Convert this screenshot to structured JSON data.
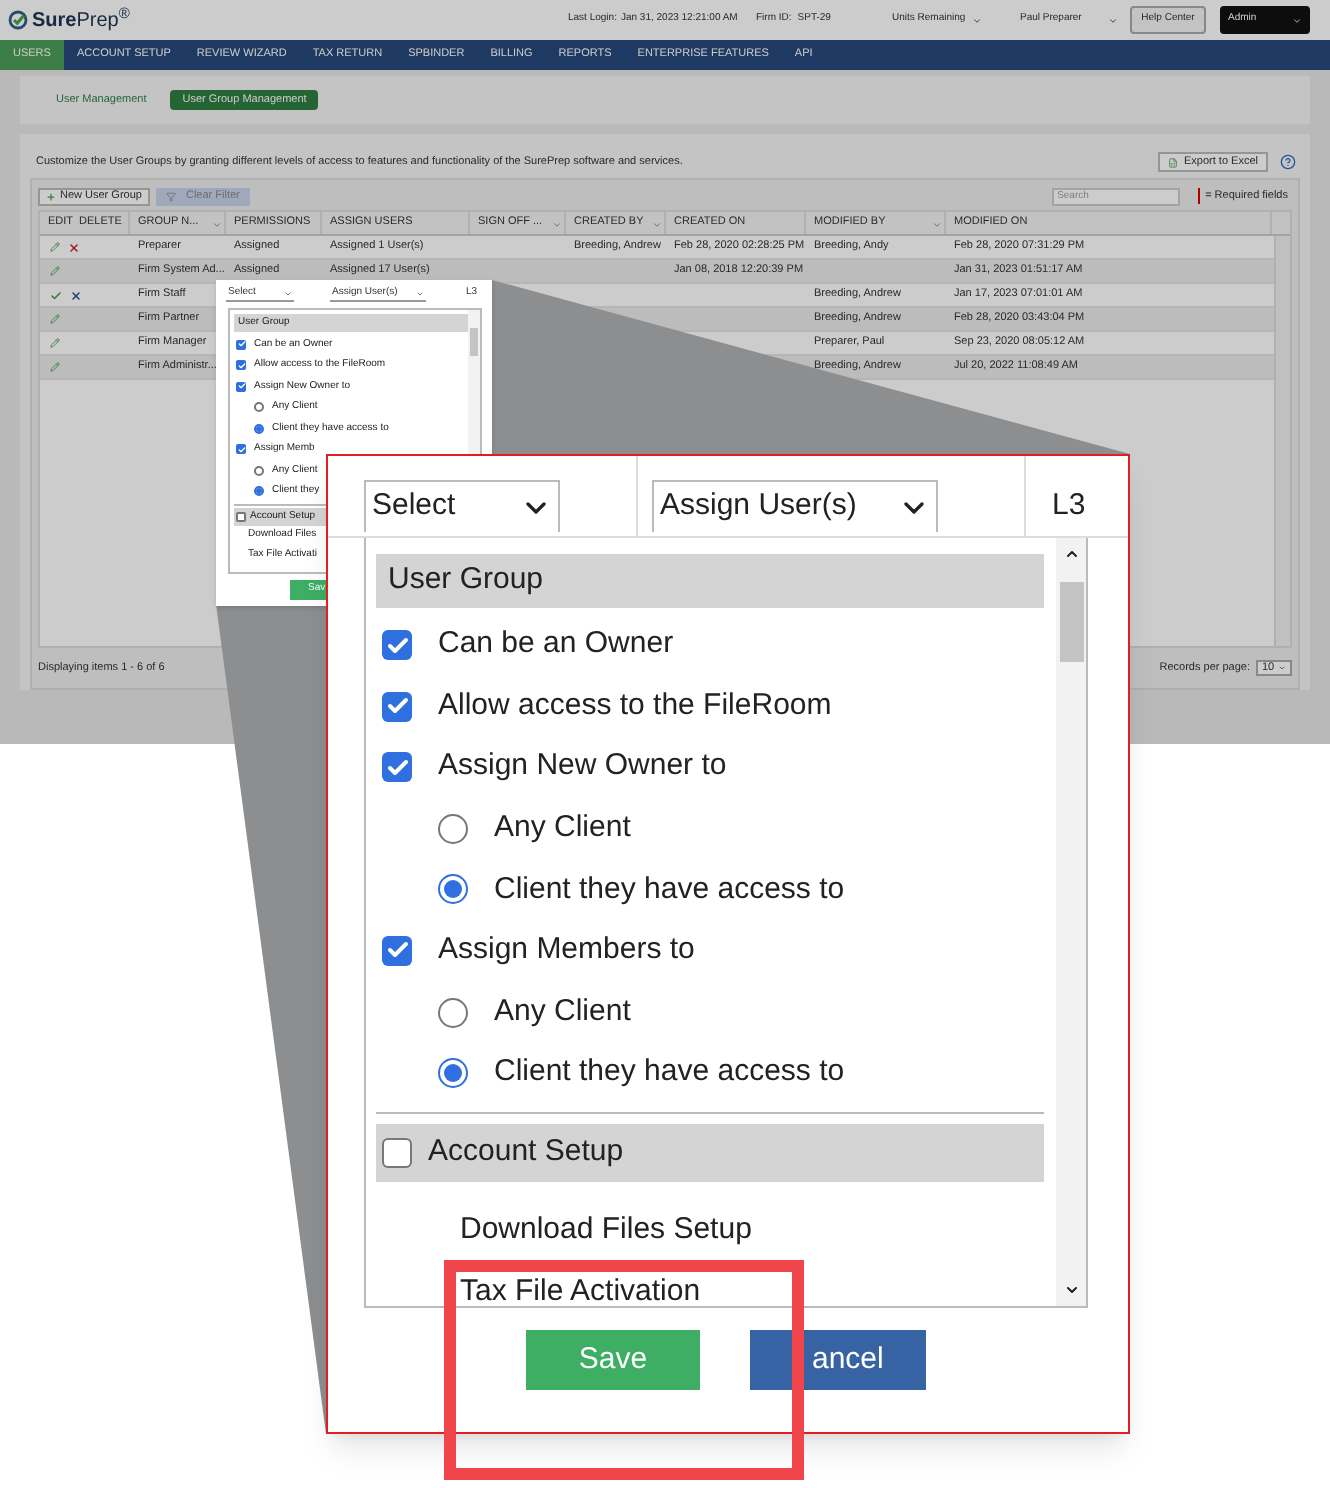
{
  "header": {
    "logo": "**Sure**Prep$^{®}$",
    "last_login_label": "Last Login:",
    "last_login": "Jan 31, 2023 12:21:00 AM",
    "firm_id_label": "Firm ID:",
    "firm_id": "SPT-29",
    "units": "Units Remaining",
    "user": "Paul Preparer",
    "help": "Help Center",
    "role": "Admin"
  },
  "nav": [
    {
      "label": "USERS",
      "selected": true
    },
    {
      "label": "ACCOUNT SETUP",
      "selected": false
    },
    {
      "label": "REVIEW WIZARD",
      "selected": false
    },
    {
      "label": "TAX RETURN",
      "selected": false
    },
    {
      "label": "SPBINDER",
      "selected": false
    },
    {
      "label": "BILLING",
      "selected": false
    },
    {
      "label": "REPORTS",
      "selected": false
    },
    {
      "label": "ENTERPRISE FEATURES",
      "selected": false
    },
    {
      "label": "API",
      "selected": false
    }
  ],
  "subtabs": [
    {
      "label": "User Management",
      "selected": false
    },
    {
      "label": "User Group Management",
      "selected": true
    }
  ],
  "description": "Customize the User Groups by granting different levels of access to features and functionality of the SurePrep software and services.",
  "export": "Export to Excel",
  "toolbar": {
    "new": "New User Group",
    "clear": "Clear Filter",
    "search_placeholder": "Search",
    "required": "= Required fields"
  },
  "columns": [
    {
      "labels": [
        "EDIT",
        "DELETE"
      ],
      "filter": false
    },
    {
      "labels": [
        "GROUP N..."
      ],
      "filter": true
    },
    {
      "labels": [
        "PERMISSIONS"
      ],
      "filter": false
    },
    {
      "labels": [
        "ASSIGN USERS"
      ],
      "filter": false
    },
    {
      "labels": [
        "SIGN OFF ..."
      ],
      "filter": true
    },
    {
      "labels": [
        "CREATED BY"
      ],
      "filter": true
    },
    {
      "labels": [
        "CREATED ON"
      ],
      "filter": false
    },
    {
      "labels": [
        "MODIFIED BY"
      ],
      "filter": true
    },
    {
      "labels": [
        "MODIFIED ON"
      ],
      "filter": false
    }
  ],
  "rows": [
    {
      "kind": "view",
      "deletable": true,
      "cells": [
        "Preparer",
        "Assigned",
        "Assigned 1 User(s)",
        "",
        "Breeding, Andrew",
        "Feb 28, 2020 02:28:25 PM",
        "Breeding, Andy",
        "Feb 28, 2020 07:31:29 PM"
      ]
    },
    {
      "kind": "view",
      "deletable": false,
      "cells": [
        "Firm System Ad...",
        "Assigned",
        "Assigned 17 User(s)",
        "",
        "",
        "Jan 08, 2018 12:20:39 PM",
        "",
        "Jan 31, 2023 01:51:17 AM"
      ]
    },
    {
      "kind": "editing",
      "deletable": false,
      "cells": [
        "Firm Staff",
        "",
        "",
        "",
        "",
        "",
        "Breeding, Andrew",
        "Jan 17, 2023 07:01:01 AM"
      ]
    },
    {
      "kind": "view",
      "deletable": false,
      "cells": [
        "Firm Partner",
        "",
        "",
        "",
        "",
        "",
        "Breeding, Andrew",
        "Feb 28, 2020 03:43:04 PM"
      ]
    },
    {
      "kind": "view",
      "deletable": false,
      "cells": [
        "Firm Manager",
        "",
        "",
        "",
        "",
        "",
        "Preparer, Paul",
        "Sep 23, 2020 08:05:12 AM"
      ]
    },
    {
      "kind": "view",
      "deletable": false,
      "cells": [
        "Firm Administr...",
        "",
        "",
        "",
        "",
        "",
        "Breeding, Andrew",
        "Jul 20, 2022 11:08:49 AM"
      ]
    }
  ],
  "footer": {
    "status": "Displaying items 1 - 6 of 6",
    "records_label": "Records per page:",
    "records": "10"
  },
  "small_popup": {
    "select": "Select",
    "assign": "Assign User(s)",
    "level_code": "L3",
    "save": "Sav",
    "items": [
      {
        "kind": "group",
        "label": "User Group"
      },
      {
        "kind": "check",
        "label": "Can be an Owner",
        "checked": true
      },
      {
        "kind": "check",
        "label": "Allow access to the FileRoom",
        "checked": true
      },
      {
        "kind": "check",
        "label": "Assign New Owner to",
        "checked": true
      },
      {
        "kind": "radio",
        "label": "Any Client",
        "selected": false
      },
      {
        "kind": "radio",
        "label": "Client they have access to",
        "selected": true
      },
      {
        "kind": "check",
        "label": "Assign Memb",
        "checked": true
      },
      {
        "kind": "radio",
        "label": "Any Client",
        "selected": false
      },
      {
        "kind": "radio",
        "label": "Client they",
        "selected": true
      },
      {
        "kind": "group_check",
        "label": "Account Setup",
        "checked": false
      },
      {
        "kind": "plain",
        "label": "Download Files"
      },
      {
        "kind": "plain",
        "label": "Tax File Activati"
      }
    ]
  },
  "popup": {
    "select": "Select",
    "assign": "Assign User(s)",
    "level_code": "L3",
    "save": "Save",
    "cancel": "ancel",
    "items": [
      {
        "kind": "group",
        "label": "User Group"
      },
      {
        "kind": "check",
        "label": "Can be an Owner",
        "checked": true
      },
      {
        "kind": "check",
        "label": "Allow access to the FileRoom",
        "checked": true
      },
      {
        "kind": "check",
        "label": "Assign New Owner to",
        "checked": true
      },
      {
        "kind": "radio",
        "label": "Any Client",
        "selected": false
      },
      {
        "kind": "radio",
        "label": "Client they have access to",
        "selected": true
      },
      {
        "kind": "check",
        "label": "Assign Members to",
        "checked": true
      },
      {
        "kind": "radio",
        "label": "Any Client",
        "selected": false
      },
      {
        "kind": "radio",
        "label": "Client they have access to",
        "selected": true
      },
      {
        "kind": "group_check",
        "label": "Account Setup",
        "checked": false
      },
      {
        "kind": "plain",
        "label": "Download Files Setup"
      },
      {
        "kind": "plain",
        "label": "Tax File Activation"
      }
    ]
  }
}
